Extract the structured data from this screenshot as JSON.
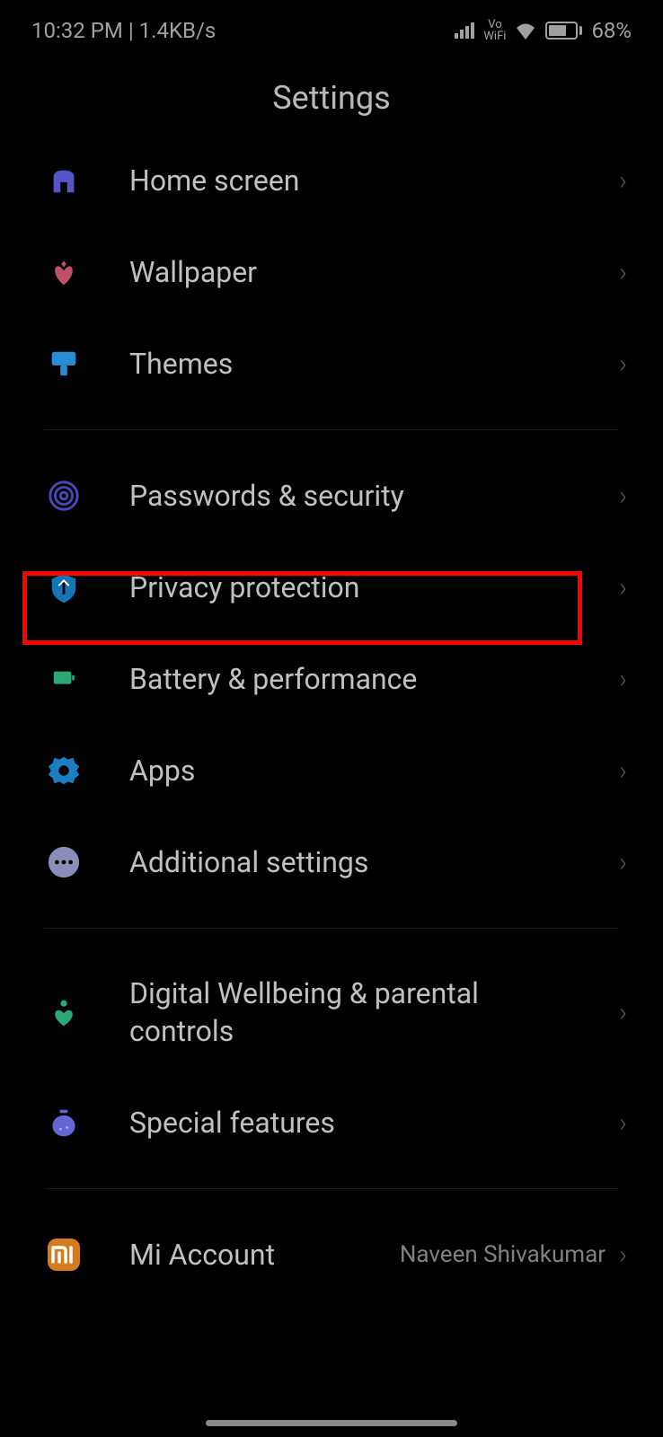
{
  "status": {
    "time": "10:32 PM",
    "separator": "|",
    "network_speed": "1.4KB/s",
    "vowifi_top": "Vo",
    "vowifi_bottom": "WiFi",
    "battery_percent": "68%"
  },
  "header": {
    "title": "Settings"
  },
  "sections": [
    {
      "items": [
        {
          "id": "home-screen",
          "label": "Home screen",
          "icon": "home-icon",
          "icon_color": "#5555c9"
        },
        {
          "id": "wallpaper",
          "label": "Wallpaper",
          "icon": "flower-icon",
          "icon_color": "#c0506a"
        },
        {
          "id": "themes",
          "label": "Themes",
          "icon": "brush-icon",
          "icon_color": "#2a8cd4"
        }
      ]
    },
    {
      "items": [
        {
          "id": "passwords-security",
          "label": "Passwords & security",
          "icon": "fingerprint-icon",
          "icon_color": "#4747b8"
        },
        {
          "id": "privacy-protection",
          "label": "Privacy protection",
          "icon": "shield-icon",
          "icon_color": "#1576b5",
          "highlighted": true
        },
        {
          "id": "battery-performance",
          "label": "Battery & performance",
          "icon": "battery-icon",
          "icon_color": "#2ba875"
        },
        {
          "id": "apps",
          "label": "Apps",
          "icon": "gear-icon",
          "icon_color": "#1a7fc2"
        },
        {
          "id": "additional-settings",
          "label": "Additional settings",
          "icon": "dots-icon",
          "icon_color": "#8a8fb8"
        }
      ]
    },
    {
      "items": [
        {
          "id": "digital-wellbeing",
          "label": "Digital Wellbeing & parental controls",
          "icon": "heart-icon",
          "icon_color": "#2ba875",
          "wide": true
        },
        {
          "id": "special-features",
          "label": "Special features",
          "icon": "bottle-icon",
          "icon_color": "#6565d6"
        }
      ]
    },
    {
      "items": [
        {
          "id": "mi-account",
          "label": "Mi Account",
          "icon": "mi-icon",
          "icon_color": "#d47a1f",
          "subtitle": "Naveen Shivakumar"
        }
      ]
    }
  ]
}
